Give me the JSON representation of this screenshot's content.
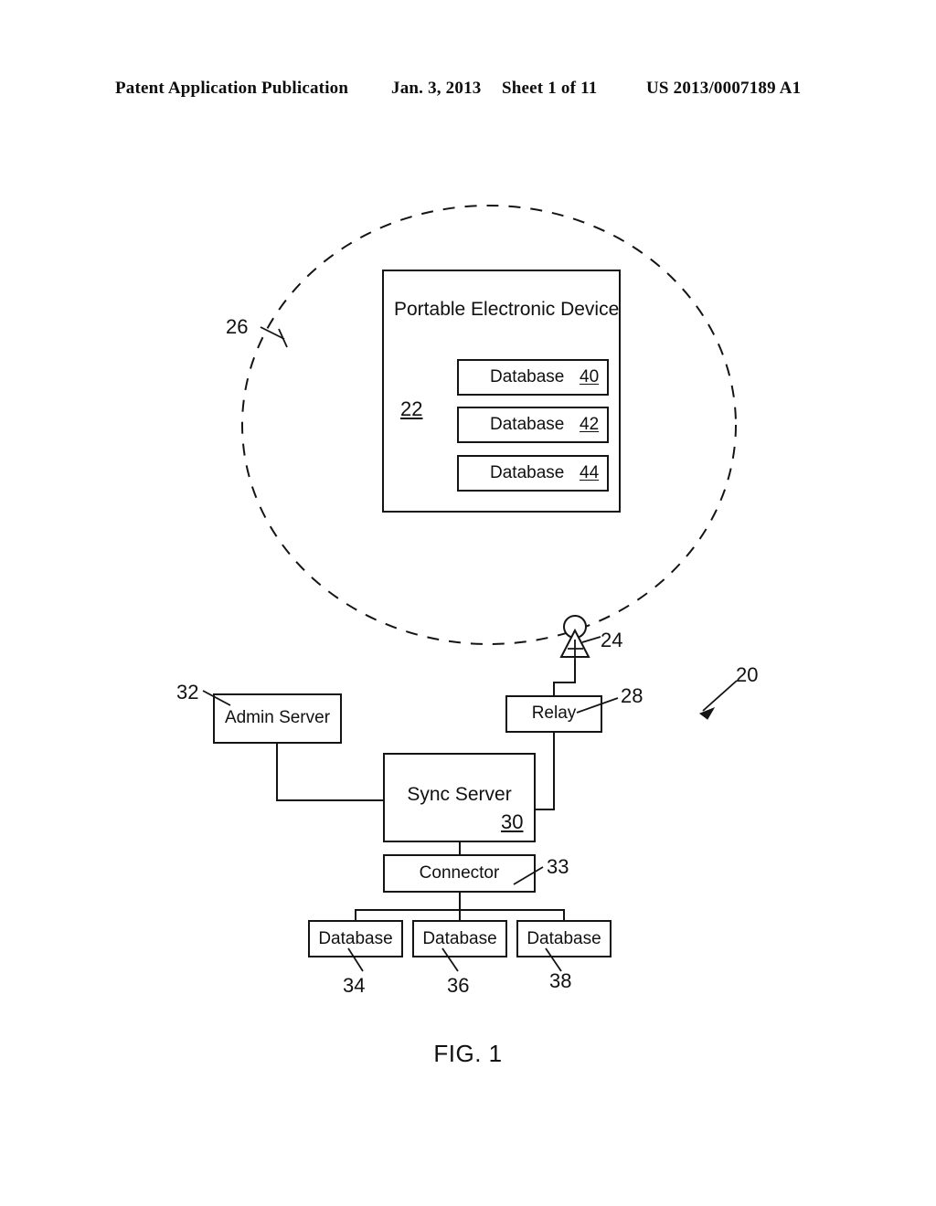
{
  "header": {
    "publication": "Patent Application Publication",
    "date": "Jan. 3, 2013",
    "sheet": "Sheet 1 of 11",
    "patent_number": "US 2013/0007189 A1"
  },
  "figure": {
    "caption": "FIG. 1",
    "system_ref": "20",
    "wireless_network_ref": "26",
    "antenna_ref": "24",
    "device": {
      "title": "Portable Electronic Device",
      "ref": "22",
      "databases": [
        {
          "label": "Database",
          "ref": "40"
        },
        {
          "label": "Database",
          "ref": "42"
        },
        {
          "label": "Database",
          "ref": "44"
        }
      ]
    },
    "nodes": {
      "admin_server": {
        "label": "Admin Server",
        "ref": "32"
      },
      "relay": {
        "label": "Relay",
        "ref": "28"
      },
      "sync_server": {
        "label": "Sync Server",
        "ref": "30"
      },
      "connector": {
        "label": "Connector",
        "ref": "33"
      }
    },
    "backend_databases": [
      {
        "label": "Database",
        "ref": "34"
      },
      {
        "label": "Database",
        "ref": "36"
      },
      {
        "label": "Database",
        "ref": "38"
      }
    ]
  }
}
